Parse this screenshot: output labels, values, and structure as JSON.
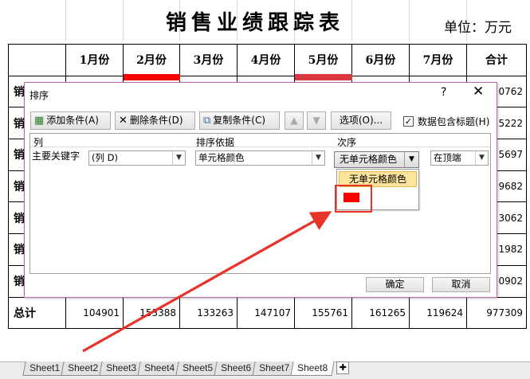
{
  "title": "销售业绩跟踪表",
  "unit_label": "单位：万元",
  "table": {
    "headers": [
      "",
      "1月份",
      "2月份",
      "3月份",
      "4月份",
      "5月份",
      "6月份",
      "7月份",
      "合计"
    ],
    "rows": [
      {
        "label": "销",
        "total": "0762"
      },
      {
        "label": "销",
        "total": "5222"
      },
      {
        "label": "销",
        "total": "5697"
      },
      {
        "label": "销",
        "total": "9682"
      },
      {
        "label": "销",
        "total": "3062"
      },
      {
        "label": "销",
        "total": "1982"
      },
      {
        "label": "销",
        "total": "0902"
      }
    ],
    "total_row": {
      "label": "总计",
      "values": [
        "104901",
        "153388",
        "133263",
        "147107",
        "155761",
        "161265",
        "119624",
        "977309"
      ]
    },
    "highlight_color": "#ff0000"
  },
  "dialog": {
    "title": "排序",
    "help": "?",
    "close": "✕",
    "toolbar": {
      "add_label": "添加条件(A)",
      "delete_label": "删除条件(D)",
      "copy_label": "复制条件(C)",
      "options_label": "选项(O)...",
      "has_header_label": "数据包含标题(H)",
      "has_header_checked": true
    },
    "columns": {
      "col": "列",
      "sort_on": "排序依据",
      "order": "次序"
    },
    "row": {
      "key_label": "主要关键字",
      "column_value": "(列 D)",
      "sort_on_value": "单元格颜色",
      "order_value": "无单元格颜色",
      "position_value": "在顶端"
    },
    "dropdown": {
      "items": [
        "无单元格颜色"
      ],
      "color_swatch": "#ff0000"
    },
    "ok_label": "确定",
    "cancel_label": "取消"
  },
  "sheets": [
    "Sheet1",
    "Sheet2",
    "Sheet3",
    "Sheet4",
    "Sheet5",
    "Sheet6",
    "Sheet7",
    "Sheet8"
  ],
  "active_sheet": "Sheet8",
  "colors": {
    "accent_border": "#b36aa5",
    "annotation": "#e8332b",
    "dropdown_highlight": "#fde49b"
  }
}
